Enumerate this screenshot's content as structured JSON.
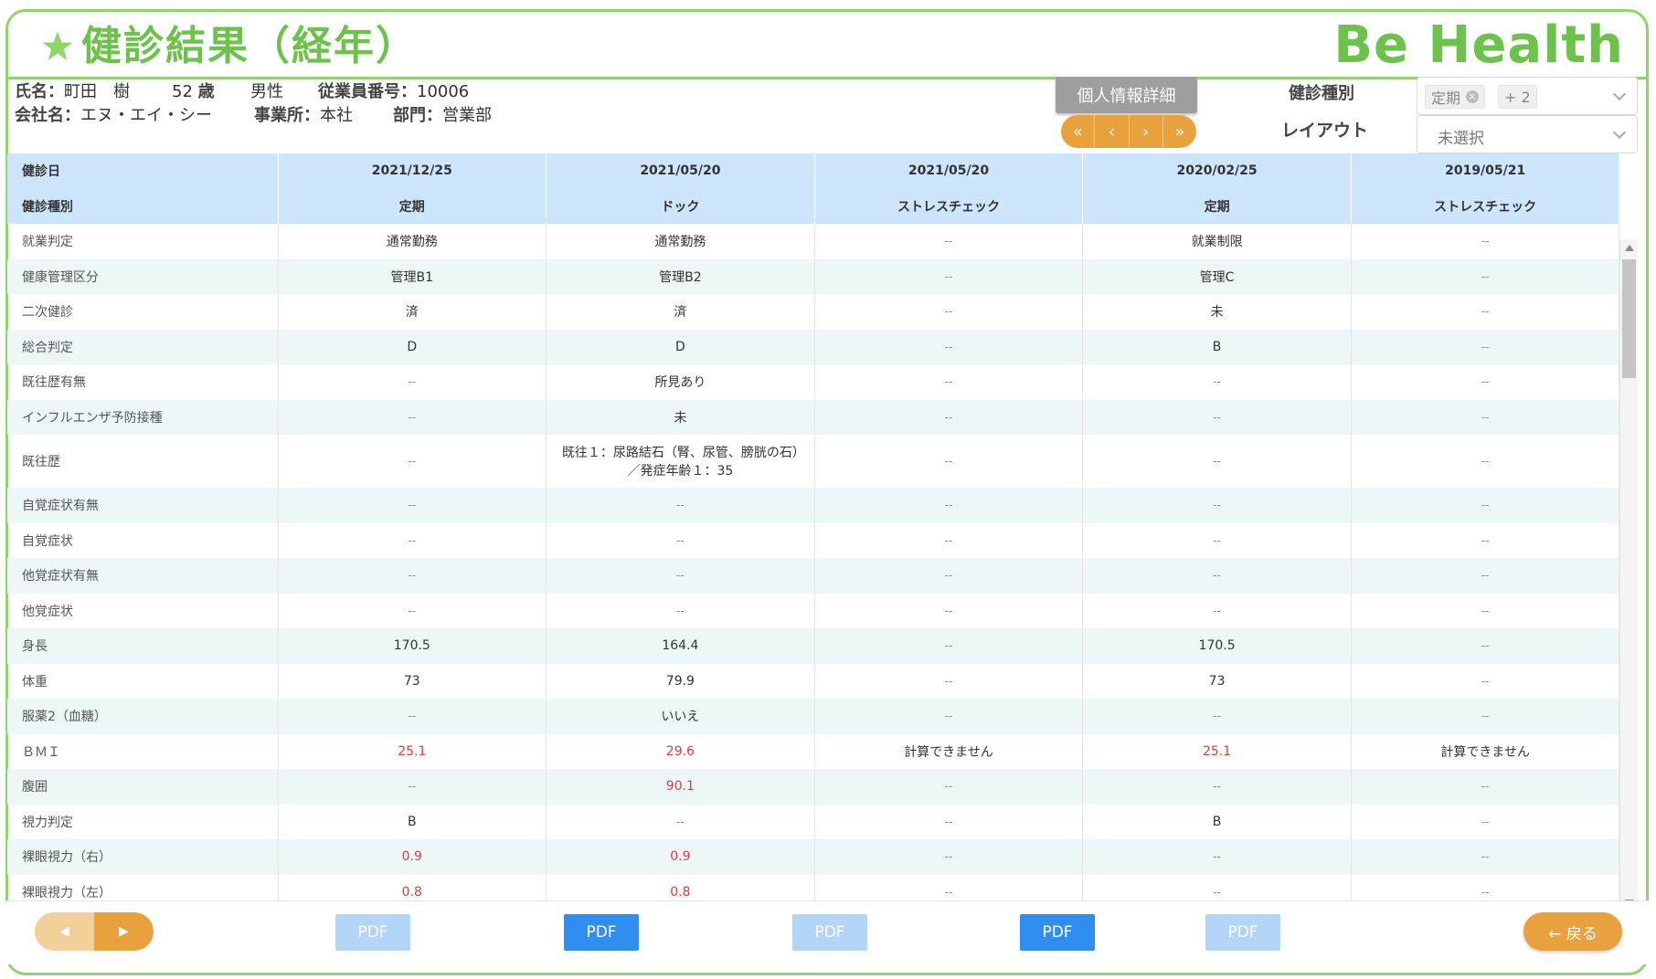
{
  "header": {
    "title": "健診結果（経年）",
    "logo": "Be Health"
  },
  "employee": {
    "name_label": "氏名：",
    "name": "町田　樹",
    "age_value": "52",
    "age_unit": "歳",
    "gender": "男性",
    "empno_label": "従業員番号：",
    "empno": "10006",
    "company_label": "会社名：",
    "company": "エヌ・エイ・シー",
    "office_label": "事業所：",
    "office": "本社",
    "dept_label": "部門：",
    "dept": "営業部"
  },
  "controls": {
    "detail_button": "個人情報詳細",
    "pager": [
      "«",
      "‹",
      "›",
      "»"
    ],
    "type_label": "健診種別",
    "layout_label": "レイアウト",
    "type_tag": "定期",
    "type_more": "+ 2",
    "layout_value": "未選択"
  },
  "table": {
    "header_rows": [
      {
        "label": "健診日",
        "cells": [
          "2021/12/25",
          "2021/05/20",
          "2021/05/20",
          "2020/02/25",
          "2019/05/21"
        ]
      },
      {
        "label": "健診種別",
        "cells": [
          "定期",
          "ドック",
          "ストレスチェック",
          "定期",
          "ストレスチェック"
        ]
      }
    ],
    "rows": [
      {
        "label": "就業判定",
        "cells": [
          "通常勤務",
          "通常勤務",
          "--",
          "就業制限",
          "--"
        ],
        "red": []
      },
      {
        "label": "健康管理区分",
        "cells": [
          "管理B1",
          "管理B2",
          "--",
          "管理C",
          "--"
        ],
        "red": []
      },
      {
        "label": "二次健診",
        "cells": [
          "済",
          "済",
          "--",
          "未",
          "--"
        ],
        "red": []
      },
      {
        "label": "総合判定",
        "cells": [
          "D",
          "D",
          "--",
          "B",
          "--"
        ],
        "red": []
      },
      {
        "label": "既往歴有無",
        "cells": [
          "--",
          "所見あり",
          "--",
          "--",
          "--"
        ],
        "red": []
      },
      {
        "label": "インフルエンザ予防接種",
        "cells": [
          "--",
          "未",
          "--",
          "--",
          "--"
        ],
        "red": []
      },
      {
        "label": "既往歴",
        "cells": [
          "--",
          "既往１：尿路結石（腎、尿管、膀胱の石）／発症年齢１：35",
          "--",
          "--",
          "--"
        ],
        "red": [],
        "tall": true
      },
      {
        "label": "自覚症状有無",
        "cells": [
          "--",
          "--",
          "--",
          "--",
          "--"
        ],
        "red": []
      },
      {
        "label": "自覚症状",
        "cells": [
          "--",
          "--",
          "--",
          "--",
          "--"
        ],
        "red": []
      },
      {
        "label": "他覚症状有無",
        "cells": [
          "--",
          "--",
          "--",
          "--",
          "--"
        ],
        "red": []
      },
      {
        "label": "他覚症状",
        "cells": [
          "--",
          "--",
          "--",
          "--",
          "--"
        ],
        "red": []
      },
      {
        "label": "身長",
        "cells": [
          "170.5",
          "164.4",
          "--",
          "170.5",
          "--"
        ],
        "red": []
      },
      {
        "label": "体重",
        "cells": [
          "73",
          "79.9",
          "--",
          "73",
          "--"
        ],
        "red": []
      },
      {
        "label": "服薬2（血糖）",
        "cells": [
          "--",
          "いいえ",
          "--",
          "--",
          "--"
        ],
        "red": []
      },
      {
        "label": "ＢＭＩ",
        "cells": [
          "25.1",
          "29.6",
          "計算できません",
          "25.1",
          "計算できません"
        ],
        "red": [
          0,
          1,
          3
        ]
      },
      {
        "label": "腹囲",
        "cells": [
          "--",
          "90.1",
          "--",
          "--",
          "--"
        ],
        "red": [
          1
        ]
      },
      {
        "label": "視力判定",
        "cells": [
          "B",
          "--",
          "--",
          "B",
          "--"
        ],
        "red": []
      },
      {
        "label": "裸眼視力（右）",
        "cells": [
          "0.9",
          "0.9",
          "--",
          "--",
          "--"
        ],
        "red": [
          0,
          1
        ]
      },
      {
        "label": "裸眼視力（左）",
        "cells": [
          "0.8",
          "0.8",
          "--",
          "--",
          "--"
        ],
        "red": [
          0,
          1
        ]
      }
    ]
  },
  "footer": {
    "pdf_label": "PDF",
    "pdf_enabled": [
      false,
      true,
      false,
      true,
      false
    ],
    "back_label": "← 戻る"
  },
  "colors": {
    "brand_green": "#6cc24a",
    "accent_orange": "#e8a13c",
    "header_blue": "#cde6fb",
    "pdf_blue": "#2f8ef0",
    "alert_red": "#e53935"
  }
}
